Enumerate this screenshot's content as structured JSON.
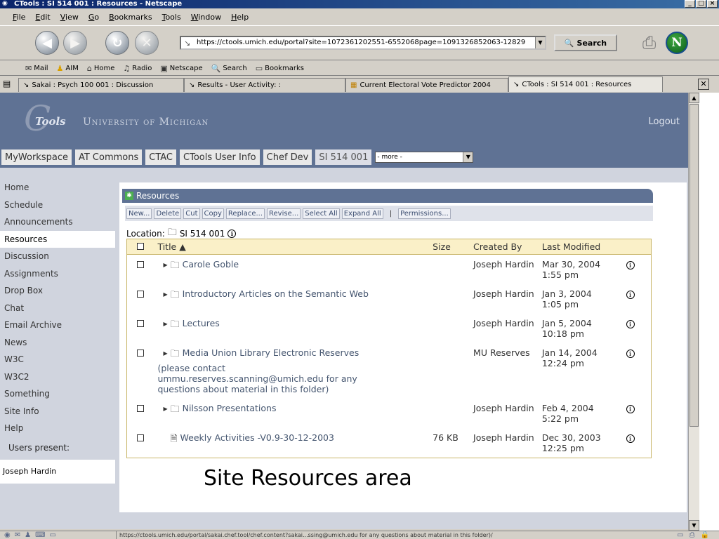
{
  "window": {
    "title": "CTools : SI 514 001 : Resources - Netscape"
  },
  "menu": [
    "File",
    "Edit",
    "View",
    "Go",
    "Bookmarks",
    "Tools",
    "Window",
    "Help"
  ],
  "nav": {
    "url": "https://ctools.umich.edu/portal?site=1072361202551-6552068page=1091326852063-12829",
    "search_label": "Search"
  },
  "personal_toolbar": [
    "Mail",
    "AIM",
    "Home",
    "Radio",
    "Netscape",
    "Search",
    "Bookmarks"
  ],
  "tabs": [
    {
      "label": "Sakai : Psych 100 001 : Discussion"
    },
    {
      "label": "Results - User Activity: :"
    },
    {
      "label": "Current Electoral Vote Predictor 2004"
    },
    {
      "label": "CTools : SI 514 001 : Resources"
    }
  ],
  "header": {
    "logo_text": "Tools",
    "university": "University of Michigan",
    "logout": "Logout"
  },
  "site_tabs": [
    "MyWorkspace",
    "AT Commons",
    "CTAC",
    "CTools User Info",
    "Chef Dev",
    "SI 514 001"
  ],
  "more_select": "- more -",
  "left_nav": {
    "items": [
      "Home",
      "Schedule",
      "Announcements",
      "Resources",
      "Discussion",
      "Assignments",
      "Drop Box",
      "Chat",
      "Email Archive",
      "News",
      "W3C",
      "W3C2",
      "Something",
      "Site Info",
      "Help"
    ],
    "current": "Resources",
    "users_present_label": "Users present:",
    "users": [
      "Joseph Hardin"
    ]
  },
  "resources": {
    "panel_title": "Resources",
    "toolbar": [
      "New...",
      "Delete",
      "Cut",
      "Copy",
      "Replace...",
      "Revise...",
      "Select All",
      "Expand All"
    ],
    "permissions": "Permissions...",
    "separator": "|",
    "location_label": "Location:",
    "location_value": "SI 514 001",
    "columns": {
      "title": "Title",
      "size": "Size",
      "created_by": "Created By",
      "last_modified": "Last Modified"
    },
    "rows": [
      {
        "title": "Carole Goble",
        "note": "",
        "size": "",
        "created_by": "Joseph Hardin",
        "modified_date": "Mar 30, 2004",
        "modified_time": "1:55 pm"
      },
      {
        "title": "Introductory Articles on the Semantic Web",
        "note": "",
        "size": "",
        "created_by": "Joseph Hardin",
        "modified_date": "Jan 3, 2004",
        "modified_time": "1:05 pm"
      },
      {
        "title": "Lectures",
        "note": "",
        "size": "",
        "created_by": "Joseph Hardin",
        "modified_date": "Jan 5, 2004",
        "modified_time": "10:18 pm"
      },
      {
        "title": "Media Union Library Electronic Reserves",
        "note": "(please contact ummu.reserves.scanning@umich.edu for any questions about material in this folder)",
        "size": "",
        "created_by": "MU Reserves",
        "modified_date": "Jan 14, 2004",
        "modified_time": "12:24 pm"
      },
      {
        "title": "Nilsson Presentations",
        "note": "",
        "size": "",
        "created_by": "Joseph Hardin",
        "modified_date": "Feb 4, 2004",
        "modified_time": "5:22 pm"
      },
      {
        "title": "Weekly Activities -V0.9-30-12-2003",
        "note": "",
        "size": "76 KB",
        "created_by": "Joseph Hardin",
        "modified_date": "Dec 30, 2003",
        "modified_time": "12:25 pm"
      }
    ]
  },
  "caption": "Site Resources area",
  "status_text": "https://ctools.umich.edu/portal/sakai.chef.tool/chef.content?sakai...ssing@umich.edu for any questions about material in this folder)/"
}
